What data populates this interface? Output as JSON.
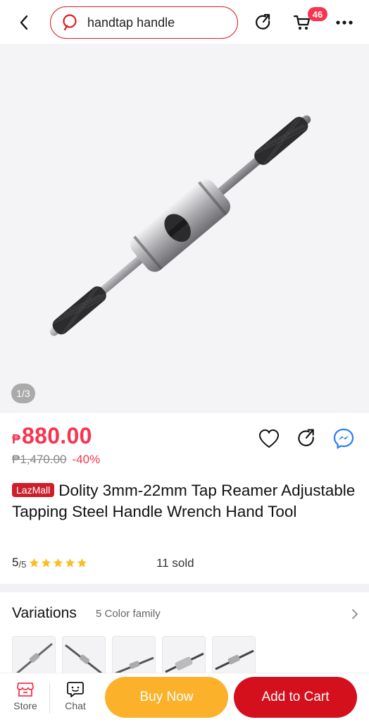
{
  "header": {
    "search_query": "handtap handle",
    "cart_count": "46"
  },
  "gallery": {
    "pager": "1/3"
  },
  "product": {
    "currency": "₱",
    "price": "880.00",
    "original_price": "₱1,470.00",
    "discount": "-40%",
    "badge": "LazMall",
    "title": "Dolity 3mm-22mm Tap Reamer Adjustable Tapping Steel Handle Wrench Hand Tool",
    "rating_value": "5",
    "rating_scale": "/5",
    "rating_stars": 5,
    "sold": "11 sold"
  },
  "variations": {
    "title": "Variations",
    "subtitle": "5 Color family"
  },
  "bottom_bar": {
    "store_label": "Store",
    "chat_label": "Chat",
    "buy_now": "Buy Now",
    "add_to_cart": "Add to Cart"
  },
  "colors": {
    "accent_red": "#f7344e",
    "buy_now": "#fbb12a",
    "add_to_cart": "#d4101d",
    "star": "#fbbd1f"
  }
}
